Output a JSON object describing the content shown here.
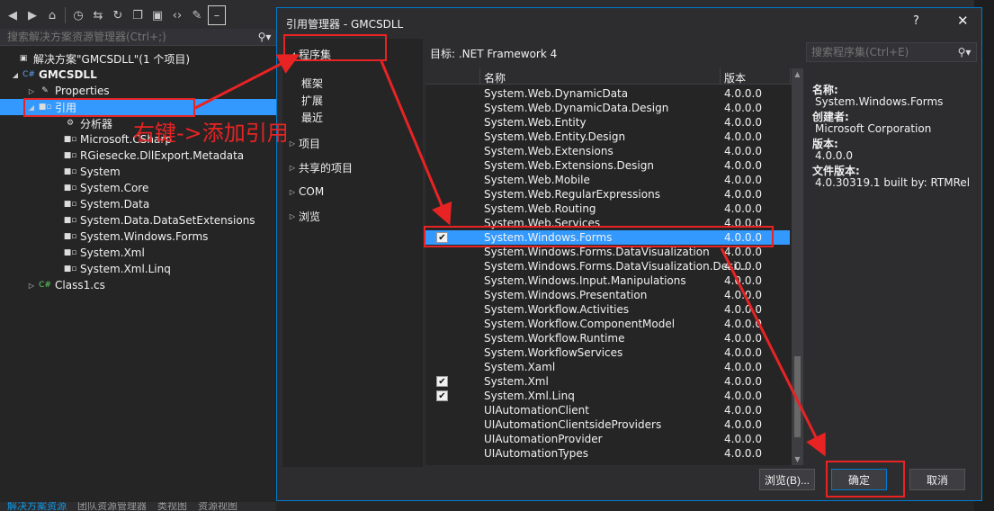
{
  "solution_explorer": {
    "toolbar_icons": [
      "back-icon",
      "forward-icon",
      "home-icon",
      "history-icon",
      "sync-icon",
      "refresh-icon",
      "collapse-icon",
      "show-all-icon",
      "code-icon",
      "wrench-icon",
      "pin-icon"
    ],
    "search_placeholder": "搜索解决方案资源管理器(Ctrl+;)",
    "solution_label": "解决方案\"GMCSDLL\"(1 个项目)",
    "project_label": "GMCSDLL",
    "properties_label": "Properties",
    "references_label": "引用",
    "references": [
      "分析器",
      "Microsoft.CSharp",
      "RGiesecke.DllExport.Metadata",
      "System",
      "System.Core",
      "System.Data",
      "System.Data.DataSetExtensions",
      "System.Windows.Forms",
      "System.Xml",
      "System.Xml.Linq"
    ],
    "class_file": "Class1.cs",
    "bottom_tabs": [
      "解决方案资源",
      "团队资源管理器",
      "类视图",
      "资源视图"
    ]
  },
  "dialog": {
    "title": "引用管理器 - GMCSDLL",
    "help": "?",
    "close": "✕",
    "nav": {
      "assemblies": "程序集",
      "framework": "框架",
      "extensions": "扩展",
      "recent": "最近",
      "projects": "项目",
      "shared_projects": "共享的项目",
      "com": "COM",
      "browse": "浏览"
    },
    "target": "目标: .NET Framework 4",
    "search_placeholder": "搜索程序集(Ctrl+E)",
    "columns": {
      "name": "名称",
      "version": "版本"
    },
    "rows": [
      {
        "name": "System.Web.DynamicData",
        "version": "4.0.0.0",
        "checked": false
      },
      {
        "name": "System.Web.DynamicData.Design",
        "version": "4.0.0.0",
        "checked": false
      },
      {
        "name": "System.Web.Entity",
        "version": "4.0.0.0",
        "checked": false
      },
      {
        "name": "System.Web.Entity.Design",
        "version": "4.0.0.0",
        "checked": false
      },
      {
        "name": "System.Web.Extensions",
        "version": "4.0.0.0",
        "checked": false
      },
      {
        "name": "System.Web.Extensions.Design",
        "version": "4.0.0.0",
        "checked": false
      },
      {
        "name": "System.Web.Mobile",
        "version": "4.0.0.0",
        "checked": false
      },
      {
        "name": "System.Web.RegularExpressions",
        "version": "4.0.0.0",
        "checked": false
      },
      {
        "name": "System.Web.Routing",
        "version": "4.0.0.0",
        "checked": false
      },
      {
        "name": "System.Web.Services",
        "version": "4.0.0.0",
        "checked": false
      },
      {
        "name": "System.Windows.Forms",
        "version": "4.0.0.0",
        "checked": true
      },
      {
        "name": "System.Windows.Forms.DataVisualization",
        "version": "4.0.0.0",
        "checked": false
      },
      {
        "name": "System.Windows.Forms.DataVisualization.Desi...",
        "version": "4.0.0.0",
        "checked": false
      },
      {
        "name": "System.Windows.Input.Manipulations",
        "version": "4.0.0.0",
        "checked": false
      },
      {
        "name": "System.Windows.Presentation",
        "version": "4.0.0.0",
        "checked": false
      },
      {
        "name": "System.Workflow.Activities",
        "version": "4.0.0.0",
        "checked": false
      },
      {
        "name": "System.Workflow.ComponentModel",
        "version": "4.0.0.0",
        "checked": false
      },
      {
        "name": "System.Workflow.Runtime",
        "version": "4.0.0.0",
        "checked": false
      },
      {
        "name": "System.WorkflowServices",
        "version": "4.0.0.0",
        "checked": false
      },
      {
        "name": "System.Xaml",
        "version": "4.0.0.0",
        "checked": false
      },
      {
        "name": "System.Xml",
        "version": "4.0.0.0",
        "checked": true
      },
      {
        "name": "System.Xml.Linq",
        "version": "4.0.0.0",
        "checked": true
      },
      {
        "name": "UIAutomationClient",
        "version": "4.0.0.0",
        "checked": false
      },
      {
        "name": "UIAutomationClientsideProviders",
        "version": "4.0.0.0",
        "checked": false
      },
      {
        "name": "UIAutomationProvider",
        "version": "4.0.0.0",
        "checked": false
      },
      {
        "name": "UIAutomationTypes",
        "version": "4.0.0.0",
        "checked": false
      }
    ],
    "selected_row": "System.Windows.Forms",
    "details": {
      "name_label": "名称:",
      "name_value": "System.Windows.Forms",
      "creator_label": "创建者:",
      "creator_value": "Microsoft Corporation",
      "version_label": "版本:",
      "version_value": "4.0.0.0",
      "file_version_label": "文件版本:",
      "file_version_value": "4.0.30319.1 built by: RTMRel"
    },
    "buttons": {
      "browse": "浏览(B)...",
      "ok": "确定",
      "cancel": "取消"
    }
  },
  "annotation": {
    "text": "右键->添加引用",
    "color": "#e82323"
  }
}
